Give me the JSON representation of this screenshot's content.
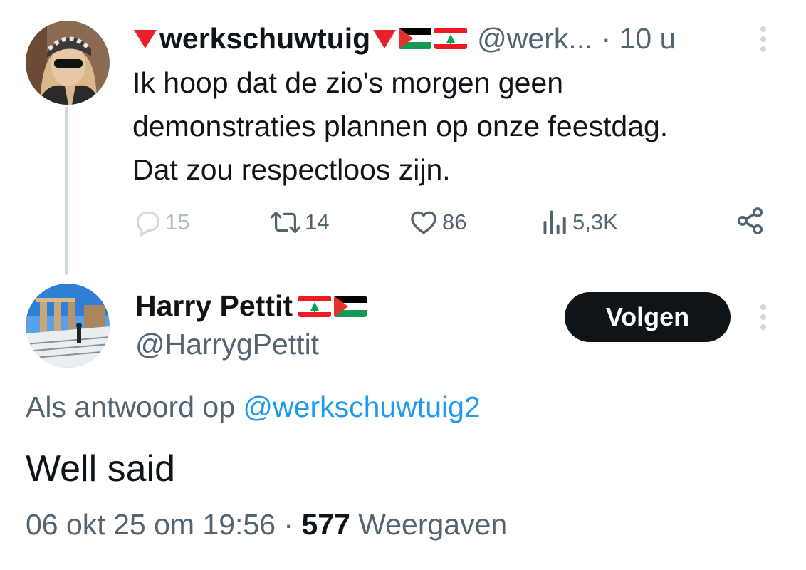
{
  "tweet1": {
    "display_name": "werkschuwtuig",
    "handle": "@werk...",
    "time": "· 10 u",
    "text": "Ik hoop dat de zio's morgen geen\ndemonstraties plannen op onze feestdag.\nDat zou respectloos zijn.",
    "name_decorations": [
      "red-triangle-icon",
      "palestine-flag-icon",
      "lebanon-flag-icon"
    ],
    "actions": {
      "replies": "15",
      "retweets": "14",
      "likes": "86",
      "views": "5,3K"
    }
  },
  "tweet2": {
    "display_name": "Harry Pettit",
    "handle": "@HarrygPettit",
    "name_decorations": [
      "lebanon-flag-icon",
      "palestine-flag-icon"
    ],
    "follow_label": "Volgen",
    "reply_prefix": "Als antwoord op ",
    "reply_to_handle": "@werkschuwtuig2",
    "text": "Well said",
    "timestamp": "06 okt 25 om 19:56 · ",
    "views_count": "577",
    "views_label": " Weergaven"
  },
  "colors": {
    "text": "#0f1419",
    "secondary": "#536471",
    "link": "#1d9bf0",
    "button_bg": "#0f1419",
    "thread_line": "#cfd9de",
    "triangle_red": "#e8202a"
  }
}
